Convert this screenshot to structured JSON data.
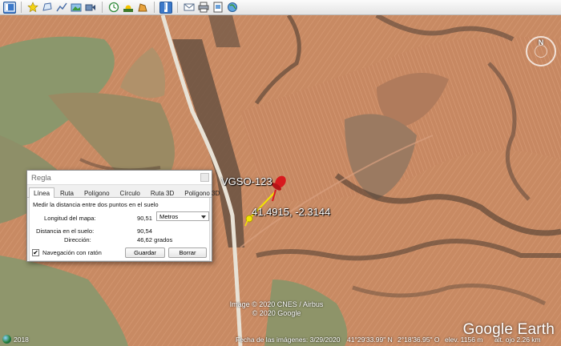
{
  "toolbar": {
    "buttons": [
      {
        "icon": "sidebar-toggle-icon",
        "active": true
      },
      {
        "icon": "placemark-add-icon"
      },
      {
        "icon": "polygon-add-icon"
      },
      {
        "icon": "path-add-icon"
      },
      {
        "icon": "image-overlay-icon"
      },
      {
        "icon": "tour-record-icon"
      },
      {
        "icon": "historical-imagery-icon"
      },
      {
        "icon": "sunlight-icon"
      },
      {
        "icon": "planet-switch-icon"
      },
      {
        "icon": "ruler-icon",
        "active": true
      },
      {
        "icon": "email-icon"
      },
      {
        "icon": "print-icon"
      },
      {
        "icon": "save-image-icon"
      },
      {
        "icon": "view-in-maps-icon"
      }
    ]
  },
  "map": {
    "placemark_name": "VGSO-123",
    "coordinates_label": "41.4915, -2.3144",
    "attribution_line1": "Image © 2020 CNES / Airbus",
    "attribution_line2": "© 2020 Google",
    "logo_text": "Google Earth",
    "compass_label": "N"
  },
  "statusbar": {
    "year": "2018",
    "imagery_date": "Fecha de las imágenes: 3/29/2020",
    "latitude": "41°29'33.99\" N",
    "longitude": "2°18'36.95\" O",
    "elevation": "elev.  1156 m",
    "eye_altitude": "alt. ojo   2.26 km"
  },
  "ruler_dialog": {
    "title": "Regla",
    "tabs": [
      "Línea",
      "Ruta",
      "Polígono",
      "Círculo",
      "Ruta 3D",
      "Polígono 3D"
    ],
    "active_tab": "Línea",
    "description": "Medir la distancia entre dos puntos en el suelo",
    "map_length_label": "Longitud del mapa:",
    "map_length_value": "90,51",
    "unit_selected": "Metros",
    "ground_distance_label": "Distancia en el suelo:",
    "ground_distance_value": "90,54",
    "heading_label": "Dirección:",
    "heading_value": "46,62 grados",
    "mouse_nav_label": "Navegación con ratón",
    "mouse_nav_checked": "✔",
    "save_button": "Guardar",
    "clear_button": "Borrar"
  },
  "colors": {
    "field_orange": "#c98a62",
    "field_green": "#8f9a6e",
    "road": "#e6dfd3",
    "ruler_line": "#f4e600",
    "pin_red": "#d8191d"
  }
}
